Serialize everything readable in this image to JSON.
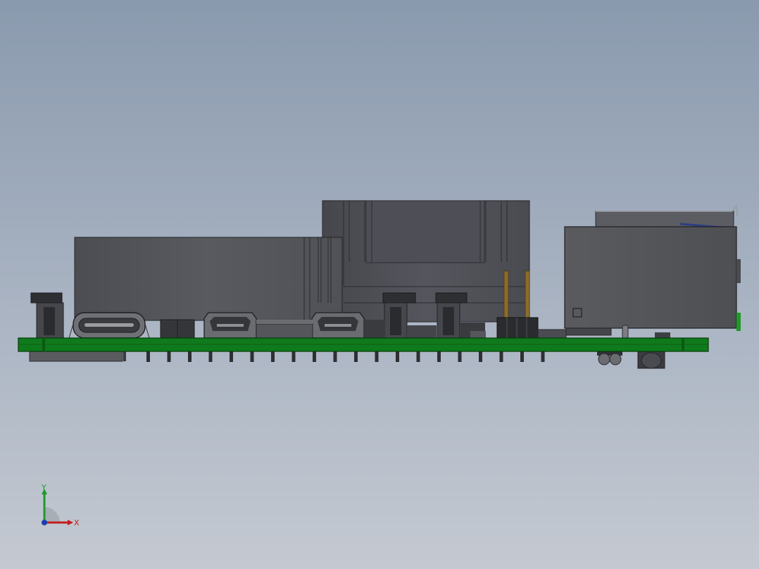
{
  "viewport": {
    "background_top": "#8a9aae",
    "background_bottom": "#c4c9d1"
  },
  "model": {
    "pcb_color": "#0f7a1c",
    "body_color": "#56585c",
    "dark_color": "#2f3034"
  },
  "triad": {
    "x_label": "X",
    "y_label": "Y",
    "x_color": "#c02020",
    "y_color": "#1e9a2a",
    "z_color": "#1a3fb0"
  }
}
